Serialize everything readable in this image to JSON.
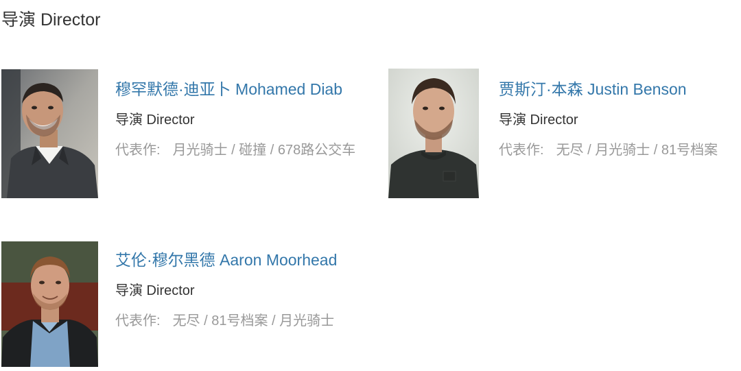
{
  "section": {
    "title": "导演 Director"
  },
  "directors": [
    {
      "name": "穆罕默德·迪亚卜 Mohamed Diab",
      "role": "导演 Director",
      "works_label": "代表作:",
      "works": [
        "月光骑士",
        "碰撞",
        "678路公交车"
      ]
    },
    {
      "name": "贾斯汀·本森 Justin Benson",
      "role": "导演 Director",
      "works_label": "代表作:",
      "works": [
        "无尽",
        "月光骑士",
        "81号档案"
      ]
    },
    {
      "name": "艾伦·穆尔黑德 Aaron Moorhead",
      "role": "导演 Director",
      "works_label": "代表作:",
      "works": [
        "无尽",
        "81号档案",
        "月光骑士"
      ]
    }
  ],
  "separator": " / ",
  "colors": {
    "link": "#3377aa",
    "text": "#333333",
    "muted": "#999999"
  }
}
